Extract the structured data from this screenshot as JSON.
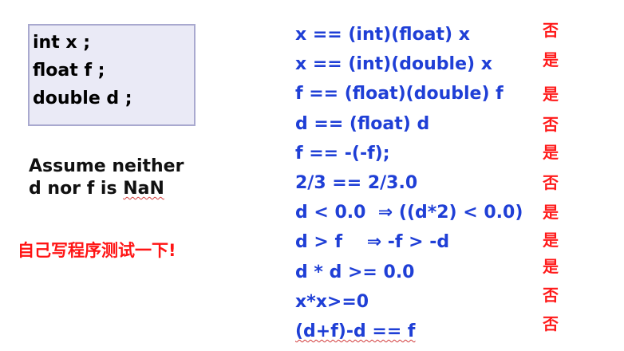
{
  "declarations": [
    "int x ;",
    "float f ;",
    "double d ;"
  ],
  "assumption": {
    "line1": "Assume neither",
    "line2_prefix": "d nor f is ",
    "line2_nan": "NaN"
  },
  "instruction": "自己写程序测试一下!",
  "expressions": [
    "x == (int)(float) x",
    "x == (int)(double) x",
    "f == (float)(double) f",
    "d == (float) d",
    "f == -(-f);",
    "2/3 == 2/3.0",
    "d < 0.0  ⇒ ((d*2) < 0.0)",
    "d > f    ⇒ -f > -d",
    "d * d >= 0.0",
    "x*x>=0",
    "(d+f)-d == f"
  ],
  "answers": [
    "否",
    "是",
    "是",
    "否",
    "是",
    "否",
    "是",
    "是",
    "是",
    "否",
    "否"
  ],
  "colors": {
    "expression": "#1f3fd6",
    "answer": "#ff1a1a",
    "box_fill": "#eaeaf6",
    "box_border": "#a9a9cf"
  }
}
